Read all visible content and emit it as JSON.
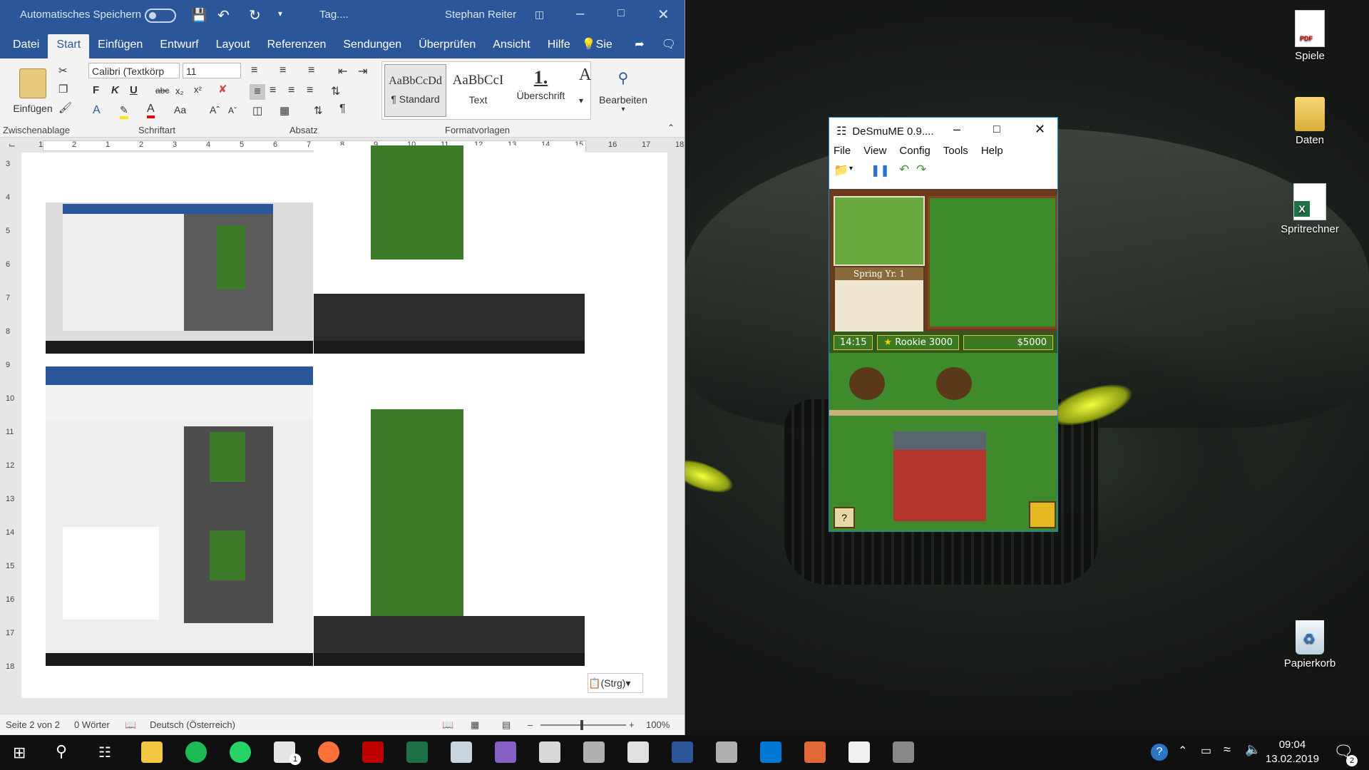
{
  "word": {
    "autosave_label": "Automatisches Speichern",
    "doc_title": "Tag....",
    "user": "Stephan Reiter",
    "tabs": [
      "Datei",
      "Start",
      "Einfügen",
      "Entwurf",
      "Layout",
      "Referenzen",
      "Sendungen",
      "Überprüfen",
      "Ansicht",
      "Hilfe"
    ],
    "tell_me": "Sie wünsc",
    "paste_label": "Einfügen",
    "font_name": "Calibri (Textkörp",
    "font_size": "11",
    "styles": [
      {
        "preview": "AaBbCcDd",
        "name": "¶ Standard"
      },
      {
        "preview": "AaBbCcI",
        "name": "Text"
      },
      {
        "preview": "1.",
        "name": "Überschrift"
      }
    ],
    "edit_label": "Bearbeiten",
    "groups": [
      "Zwischenablage",
      "Schriftart",
      "Absatz",
      "Formatvorlagen"
    ],
    "ruler_numbers": [
      "1",
      "2",
      "1",
      "2",
      "3",
      "4",
      "5",
      "6",
      "7",
      "8",
      "9",
      "10",
      "11",
      "12",
      "13",
      "14",
      "15",
      "16",
      "17",
      "18"
    ],
    "vruler_numbers": [
      "3",
      "4",
      "5",
      "6",
      "7",
      "8",
      "9",
      "10",
      "11",
      "12",
      "13",
      "14",
      "15",
      "16",
      "17",
      "18"
    ],
    "paste_options": "(Strg)",
    "status": {
      "page": "Seite 2 von 2",
      "words": "0 Wörter",
      "language": "Deutsch (Österreich)",
      "zoom": "100%"
    }
  },
  "desmume": {
    "title": "DeSmuME 0.9....",
    "menu": [
      "File",
      "View",
      "Config",
      "Tools",
      "Help"
    ],
    "game": {
      "season": "Spring Yr. 1",
      "time": "14:15",
      "rank": "Rookie 3000",
      "money": "$5000"
    }
  },
  "desktop_icons": [
    {
      "label": "Spiele",
      "icon": "pdf-icon"
    },
    {
      "label": "Daten",
      "icon": "folder-icon"
    },
    {
      "label": "Spritrechner",
      "icon": "excel-icon"
    },
    {
      "label": "Papierkorb",
      "icon": "recycle-bin-icon"
    }
  ],
  "taskbar": {
    "apps": [
      "file-explorer-icon",
      "spotify-icon",
      "whatsapp-icon",
      "mail-icon",
      "firefox-icon",
      "filezilla-icon",
      "excel-icon",
      "steam-icon",
      "visual-studio-icon",
      "paint-icon",
      "app-icon",
      "calculator-icon",
      "word-icon",
      "app-icon",
      "vscode-icon",
      "matlab-icon",
      "unity-icon",
      "desmume-icon"
    ],
    "mail_badge": "1",
    "time": "09:04",
    "date": "13.02.2019",
    "notification_count": "2"
  },
  "colors": {
    "word_blue": "#2b579a",
    "taskbar": "#101010",
    "desmume_border": "#1883d7"
  }
}
